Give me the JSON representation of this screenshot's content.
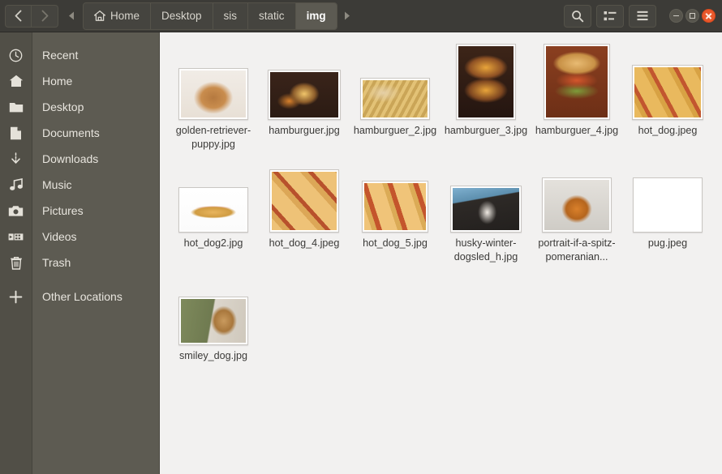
{
  "window": {
    "title": "img",
    "controls": {
      "minimize": "Minimize",
      "maximize": "Maximize",
      "close": "Close"
    }
  },
  "header": {
    "nav": {
      "back": "Back",
      "forward": "Forward",
      "crumb_scroll_left": "Scroll breadcrumbs left",
      "crumb_scroll_right": "Scroll breadcrumbs right"
    },
    "breadcrumbs": [
      {
        "label": "Home",
        "icon": "home-icon",
        "active": false
      },
      {
        "label": "Desktop",
        "icon": "",
        "active": false
      },
      {
        "label": "sis",
        "icon": "",
        "active": false
      },
      {
        "label": "static",
        "icon": "",
        "active": false
      },
      {
        "label": "img",
        "icon": "",
        "active": true
      }
    ],
    "tools": [
      {
        "name": "search-icon",
        "label": "Search"
      },
      {
        "name": "view-options-icon",
        "label": "View options"
      },
      {
        "name": "hamburger-menu-icon",
        "label": "Menu"
      }
    ]
  },
  "sidebar": {
    "items": [
      {
        "label": "Recent",
        "icon": "clock-icon"
      },
      {
        "label": "Home",
        "icon": "home-icon"
      },
      {
        "label": "Desktop",
        "icon": "folder-icon"
      },
      {
        "label": "Documents",
        "icon": "document-icon"
      },
      {
        "label": "Downloads",
        "icon": "download-icon"
      },
      {
        "label": "Music",
        "icon": "music-note-icon"
      },
      {
        "label": "Pictures",
        "icon": "camera-icon"
      },
      {
        "label": "Videos",
        "icon": "film-icon"
      },
      {
        "label": "Trash",
        "icon": "trash-icon"
      },
      {
        "label": "Other Locations",
        "icon": "plus-icon"
      }
    ]
  },
  "files": [
    {
      "name": "golden-retriever-puppy.jpg",
      "kind": "image",
      "w": 80,
      "h": 58,
      "thumb": "dog-golden-retriever",
      "selected": false
    },
    {
      "name": "hamburguer.jpg",
      "kind": "image",
      "w": 84,
      "h": 56,
      "thumb": "burger-wood-board",
      "selected": false
    },
    {
      "name": "hamburguer_2.jpg",
      "kind": "image",
      "w": 80,
      "h": 46,
      "thumb": "burger-fries",
      "selected": false
    },
    {
      "name": "hamburguer_3.jpg",
      "kind": "image",
      "w": 68,
      "h": 88,
      "thumb": "burger-stack-cheese",
      "selected": false
    },
    {
      "name": "hamburguer_4.jpg",
      "kind": "image",
      "w": 76,
      "h": 88,
      "thumb": "burger-bacon-tomato",
      "selected": false
    },
    {
      "name": "hot_dog.jpeg",
      "kind": "image",
      "w": 82,
      "h": 62,
      "thumb": "hotdogs-teal-plate",
      "selected": false
    },
    {
      "name": "hot_dog2.jpg",
      "kind": "image",
      "w": 80,
      "h": 50,
      "thumb": "hotdog-white-bg",
      "selected": false
    },
    {
      "name": "hot_dog_4.jpeg",
      "kind": "image",
      "w": 80,
      "h": 72,
      "thumb": "hotdog-tray-platter",
      "selected": true
    },
    {
      "name": "hot_dog_5.jpg",
      "kind": "image",
      "w": 76,
      "h": 58,
      "thumb": "hotdogs-grilled",
      "selected": false
    },
    {
      "name": "husky-winter-dogsled_h.jpg",
      "kind": "image",
      "w": 82,
      "h": 52,
      "thumb": "husky-snow",
      "selected": false
    },
    {
      "name": "portrait-if-a-spitz-pomeranian...",
      "kind": "image",
      "w": 80,
      "h": 62,
      "thumb": "pomeranian-spitz",
      "selected": false
    },
    {
      "name": "pug.jpeg",
      "kind": "image",
      "w": 80,
      "h": 62,
      "thumb": "pug-green-bg",
      "selected": false
    },
    {
      "name": "smiley_dog.jpg",
      "kind": "image",
      "w": 80,
      "h": 54,
      "thumb": "smiling-shiba-dog",
      "selected": false
    }
  ],
  "colors": {
    "header_bg": "#3c3b37",
    "rail_bg": "#514f47",
    "sidebar_bg": "#5d5b52",
    "content_bg": "#f2f1f0",
    "close_button": "#e9582b",
    "active_crumb": "#5c5a52",
    "text_light": "#e8e5de",
    "text_dark": "#3b3a38"
  }
}
